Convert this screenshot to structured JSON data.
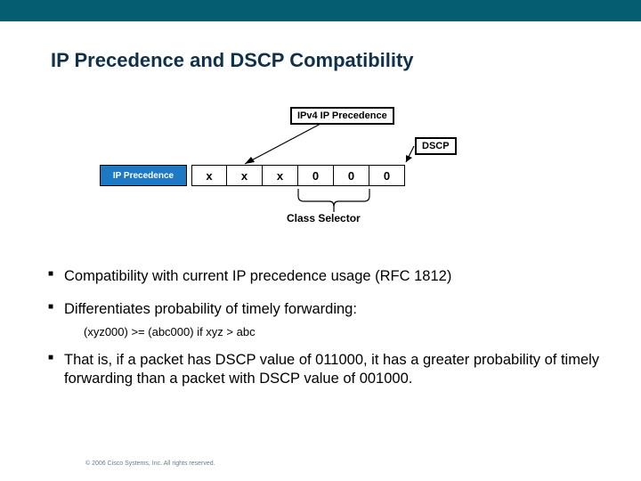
{
  "title": "IP Precedence and DSCP Compatibility",
  "diagram": {
    "ip_precedence_label": "IP Precedence",
    "ipv4_label": "IPv4 IP Precedence",
    "dscp_label": "DSCP",
    "class_selector_label": "Class Selector",
    "bits": [
      "x",
      "x",
      "x",
      "0",
      "0",
      "0"
    ]
  },
  "bullets": {
    "b1": "Compatibility with current IP precedence usage (RFC 1812)",
    "b2": "Differentiates probability of timely forwarding:",
    "b2_sub": "(xyz000) >= (abc000) if xyz > abc",
    "b3": "That is, if a packet has DSCP value of 011000, it has a greater probability of timely forwarding than a packet with DSCP value of 001000."
  },
  "footer": "© 2006 Cisco Systems, Inc. All rights reserved."
}
